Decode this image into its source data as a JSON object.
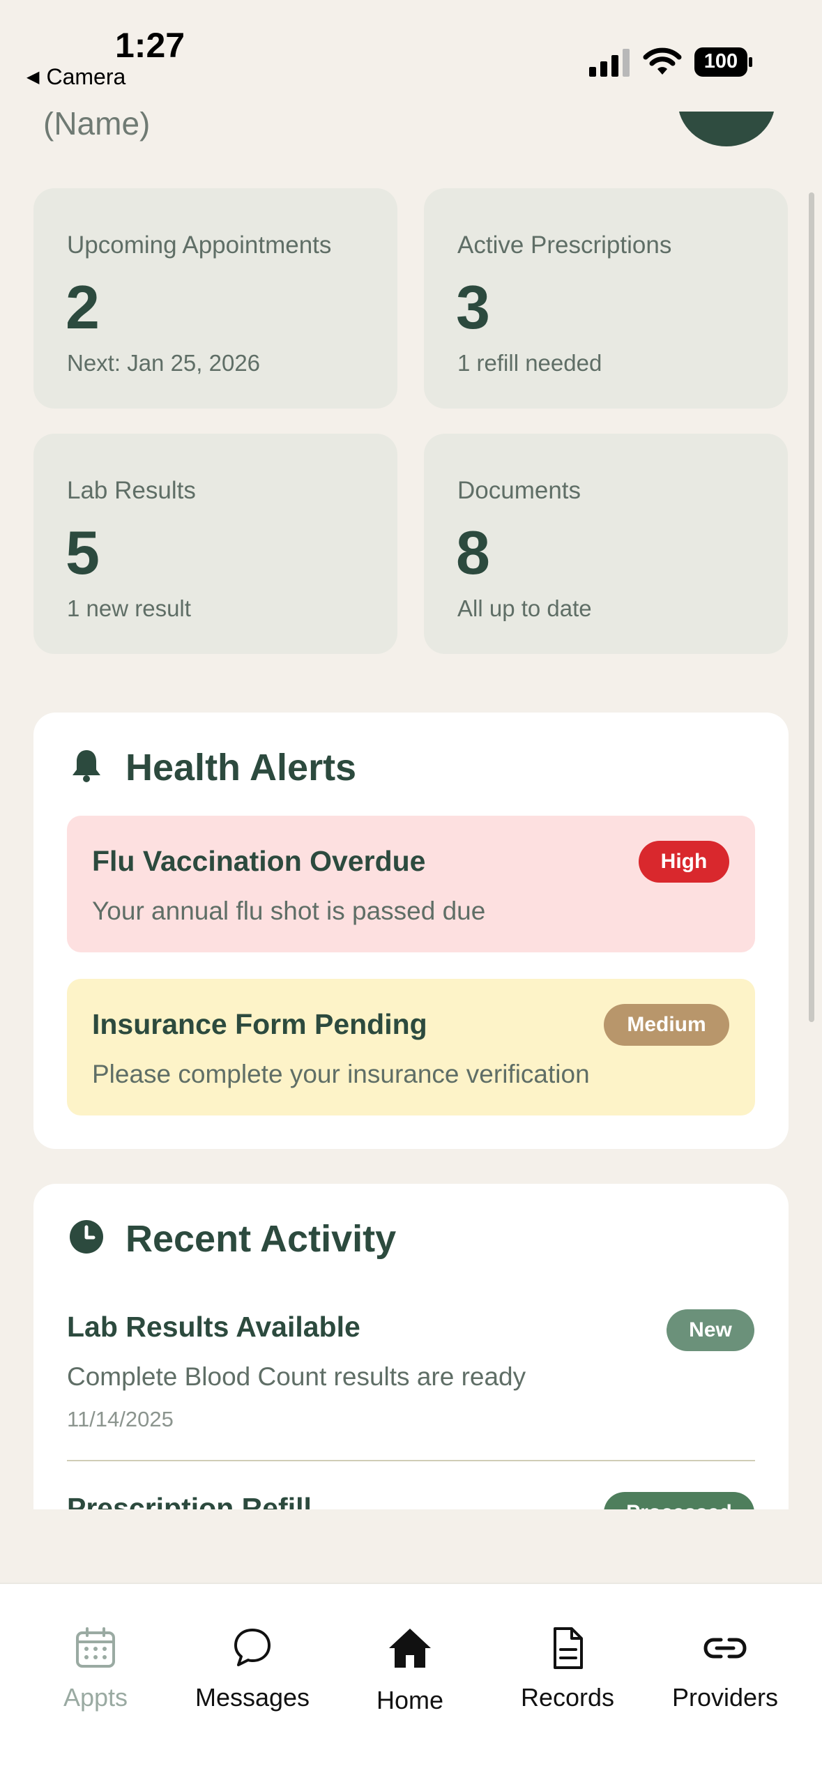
{
  "status_bar": {
    "time": "1:27",
    "back_label": "Camera",
    "battery": "100"
  },
  "header": {
    "name": "(Name)"
  },
  "stats": [
    {
      "label": "Upcoming Appointments",
      "value": "2",
      "sub": "Next: Jan 25, 2026"
    },
    {
      "label": "Active Prescriptions",
      "value": "3",
      "sub": "1 refill needed"
    },
    {
      "label": "Lab Results",
      "value": "5",
      "sub": "1 new result"
    },
    {
      "label": "Documents",
      "value": "8",
      "sub": "All up to date"
    }
  ],
  "health_alerts": {
    "title": "Health Alerts",
    "items": [
      {
        "title": "Flu Vaccination Overdue",
        "desc": "Your annual flu shot is passed due",
        "priority": "High",
        "bg": "#fde0e0",
        "badge_color": "#d9282d"
      },
      {
        "title": "Insurance Form Pending",
        "desc": "Please complete your insurance verification",
        "priority": "Medium",
        "bg": "#fdf3c8",
        "badge_color": "#b8966b"
      }
    ]
  },
  "recent_activity": {
    "title": "Recent Activity",
    "items": [
      {
        "title": "Lab Results Available",
        "desc": "Complete Blood Count results are ready",
        "date": "11/14/2025",
        "status": "New",
        "badge_color": "#6b917a"
      },
      {
        "title": "Prescription Refill",
        "status": "Processed",
        "badge_color": "#4e7e5c"
      }
    ]
  },
  "tabs": [
    {
      "label": "Appts",
      "icon": "calendar-icon",
      "active": false
    },
    {
      "label": "Messages",
      "icon": "chat-icon",
      "active": false
    },
    {
      "label": "Home",
      "icon": "home-icon",
      "active": true
    },
    {
      "label": "Records",
      "icon": "document-icon",
      "active": false
    },
    {
      "label": "Providers",
      "icon": "link-icon",
      "active": false
    }
  ]
}
